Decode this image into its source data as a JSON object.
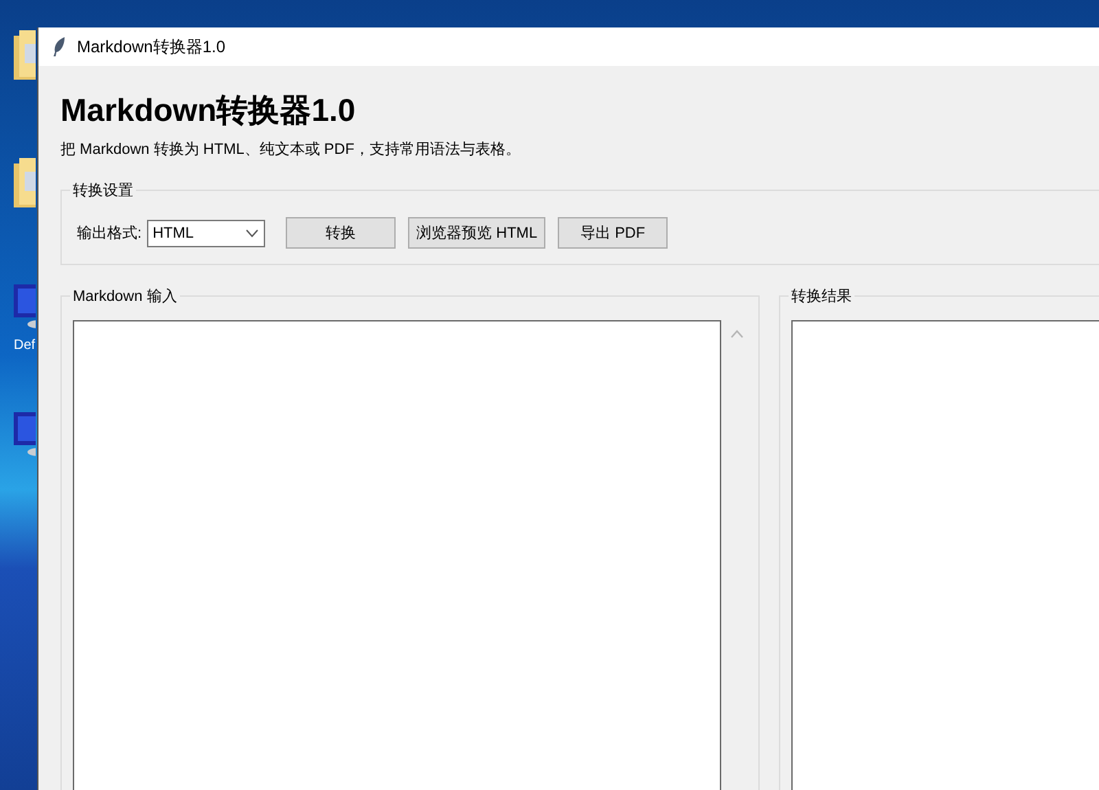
{
  "desktop": {
    "icons": [
      {
        "kind": "folder"
      },
      {
        "kind": "folder"
      },
      {
        "kind": "computer",
        "label": "Def"
      },
      {
        "kind": "computer"
      }
    ]
  },
  "window": {
    "title": "Markdown转换器1.0"
  },
  "heading": "Markdown转换器1.0",
  "description": "把 Markdown 转换为 HTML、纯文本或 PDF，支持常用语法与表格。",
  "settings": {
    "title": "转换设置",
    "format_label": "输出格式:",
    "format_value": "HTML",
    "buttons": [
      "转换",
      "浏览器预览 HTML",
      "导出 PDF"
    ]
  },
  "input_panel": {
    "title": "Markdown 输入"
  },
  "output_panel": {
    "title": "转换结果"
  }
}
